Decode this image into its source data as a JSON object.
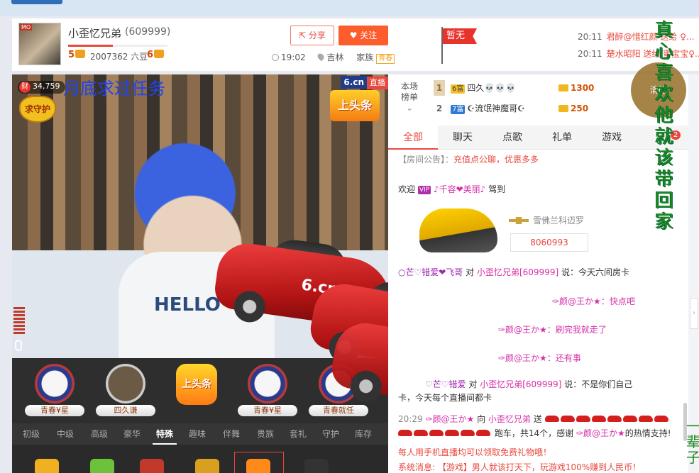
{
  "header": {
    "anchor_name": "小歪忆兄弟",
    "anchor_id": "(609999)",
    "level_left": "5",
    "beans": "2007362 六豆",
    "level_right": "6",
    "level_progress": 0.45,
    "share_label": "分享",
    "follow_label": "关注",
    "time": "19:02",
    "location": "吉林",
    "family_label": "家族",
    "family_tag": "青春",
    "flag_label": "暂无"
  },
  "gift_feed": [
    {
      "time": "20:11",
      "text": "君醉@惜红颜 送给 ♀..."
    },
    {
      "time": "20:11",
      "text": "楚水昭阳 送给 蜜宝宝♀..."
    }
  ],
  "video": {
    "fortune_label": "财",
    "fortune_count": "34,759",
    "guard_badge": "求守护",
    "overlay_text": "月底求过任务",
    "live_brand": "6.cn",
    "live_label": "直播",
    "headline_badge": "上头条",
    "shirt_text": "HELLO",
    "car_logo": "6.cn"
  },
  "guards": [
    {
      "label": "青春¥星"
    },
    {
      "label": "四久谦"
    },
    {
      "label": "上头条"
    },
    {
      "label": "青春¥星"
    },
    {
      "label": "青春就任"
    }
  ],
  "gift_tabs": [
    "初级",
    "中级",
    "高级",
    "豪华",
    "特殊",
    "趣味",
    "伴舞",
    "贵族",
    "套礼",
    "守护",
    "库存"
  ],
  "gift_tab_active": "特殊",
  "rank": {
    "label_line1": "本场",
    "label_line2": "榜单",
    "chevron": "⌄",
    "rows": [
      {
        "num": "1",
        "vip": "6富",
        "name": "四久💀💀💀",
        "coins": "1300"
      },
      {
        "num": "2",
        "vip": "7富",
        "name": "☪流氓神魔哥☪",
        "coins": "250"
      }
    ]
  },
  "chat_tabs": [
    "全部",
    "聊天",
    "点歌",
    "礼单",
    "游戏"
  ],
  "chat_tab_active": "全部",
  "tab_badge": "2",
  "chat": {
    "announce_label": "【房间公告】：",
    "announce_text": "充值点公聊，优惠多多",
    "welcome_label": "欢迎",
    "welcome_tag": "VIP",
    "welcome_user": "♪千容❤美丽♪",
    "welcome_action": "驾到",
    "car_name": "雪佛兰科迈罗",
    "car_number": "8060993",
    "msgs": [
      {
        "user": "○芒♡错爱❤飞哥",
        "mid": "对",
        "target": "小歪忆兄弟[609999]",
        "text": "说：今天六间房卡"
      },
      {
        "user": "✑颜@王か★",
        "text": "：快点吧"
      },
      {
        "user": "✑颜@王か★",
        "text": "：刷完我就走了"
      },
      {
        "user": "✑颜@王か★",
        "text": "：还有事"
      },
      {
        "user": "♡芒♡错爱",
        "mid": "对",
        "target": "小歪忆兄弟[609999]",
        "text": "说：不是你们自己"
      },
      {
        "text": "卡，今天每个直播间都卡"
      }
    ],
    "gift_time": "20:29",
    "gift_user": "✑颜@王か★",
    "gift_mid": "向",
    "gift_target": "小歪忆兄弟",
    "gift_send": "送",
    "gift_line2": "跑车，共14个，感谢",
    "gift_thanks_user": "✑颜@王か★",
    "gift_thanks_text": "的热情支持!",
    "promo": "每人用手机直播均可以领取免费礼物哦！",
    "sys_label": "系统消息:",
    "sys_text": "【游戏】男人就该打天下，玩游戏100%赚到人民币！"
  },
  "clear_screen_label": "清除",
  "vertical_text": "真心喜欢他就该带回家",
  "vertical_text2": "一辈子"
}
